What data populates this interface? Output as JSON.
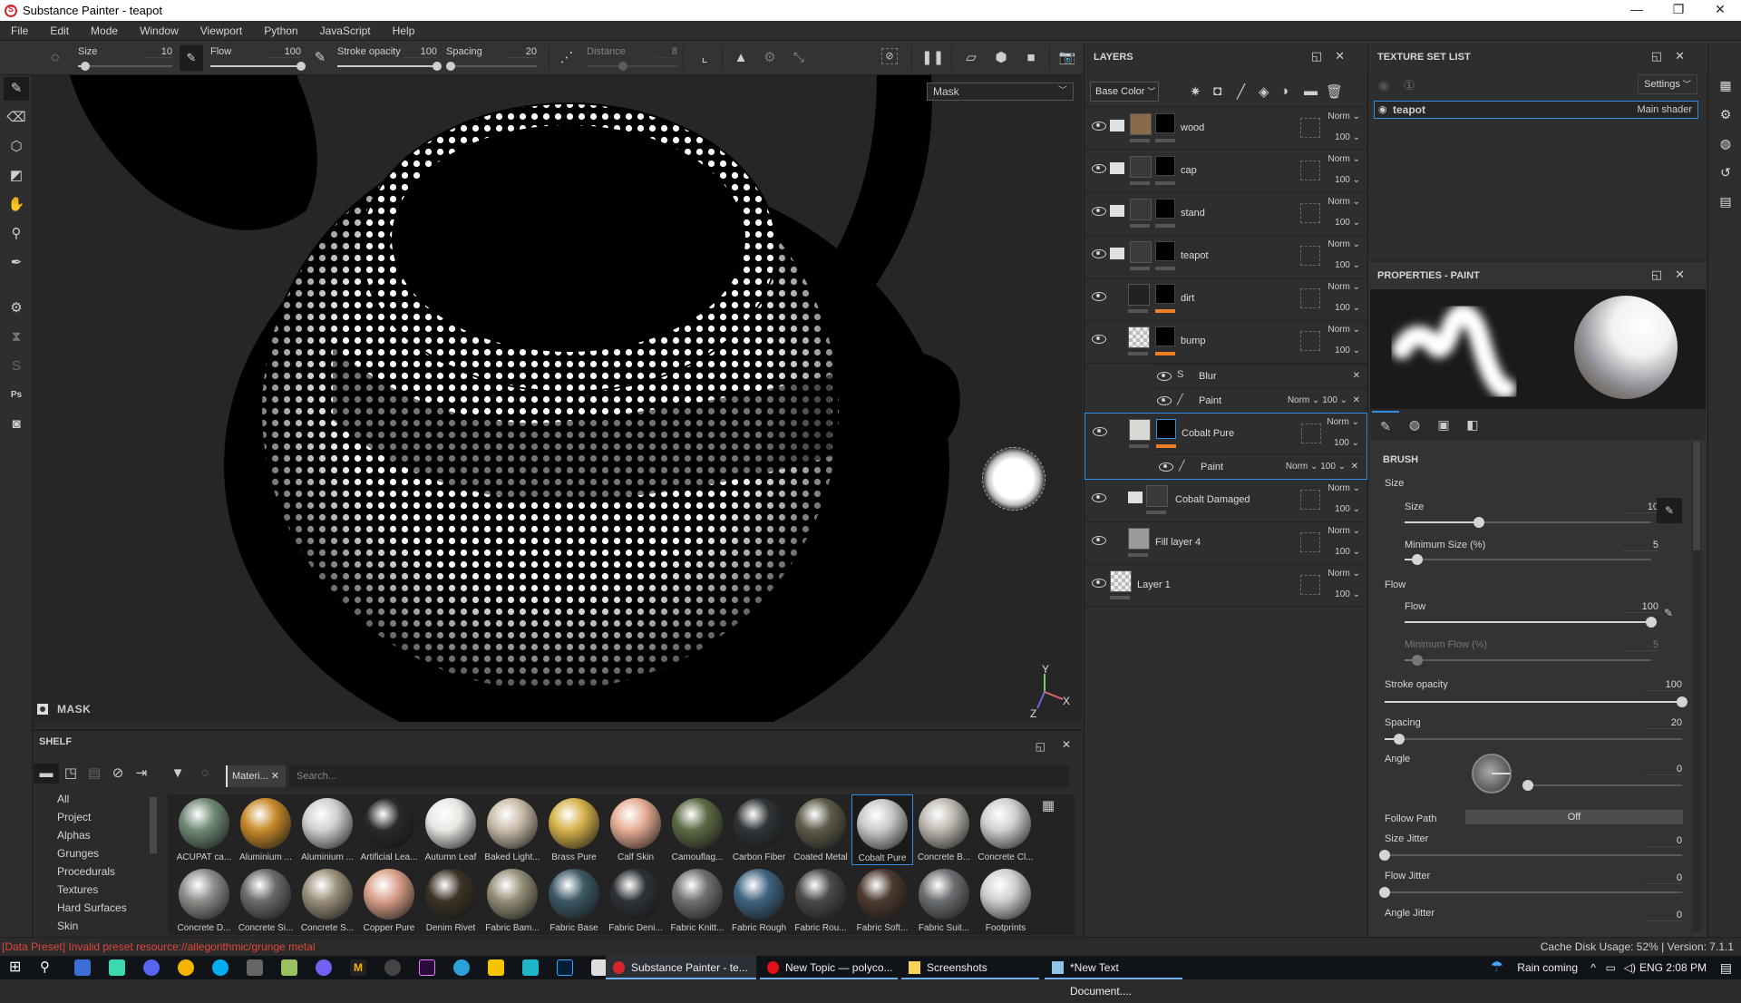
{
  "window": {
    "title": "Substance Painter - teapot",
    "minimize": "—",
    "restore": "❐",
    "close": "✕"
  },
  "menu": [
    "File",
    "Edit",
    "Mode",
    "Window",
    "Viewport",
    "Python",
    "JavaScript",
    "Help"
  ],
  "toolbar": {
    "size": {
      "label": "Size",
      "value": "10",
      "fraction": 0.08
    },
    "flow": {
      "label": "Flow",
      "value": "100",
      "fraction": 1.0
    },
    "stroke_opacity": {
      "label": "Stroke opacity",
      "value": "100",
      "fraction": 1.0
    },
    "spacing": {
      "label": "Spacing",
      "value": "20",
      "fraction": 0.05
    },
    "distance": {
      "label": "Distance",
      "value": "8",
      "fraction": 0.4,
      "disabled": true
    }
  },
  "left_tools": [
    "paint-brush",
    "eraser",
    "projection",
    "polygon-fill",
    "smudge",
    "clone-stamp",
    "color-picker",
    "substance-source",
    "bake",
    "substance-share",
    "photoshop",
    "iray"
  ],
  "viewport": {
    "channel_select": "Mask",
    "mask_label": "MASK",
    "axis": {
      "x": "X",
      "y": "Y",
      "z": "Z"
    }
  },
  "shelf": {
    "title": "SHELF",
    "filter_chip": "Materi...",
    "search_placeholder": "Search...",
    "categories": [
      "All",
      "Project",
      "Alphas",
      "Grunges",
      "Procedurals",
      "Textures",
      "Hard Surfaces",
      "Skin"
    ],
    "materials_row1": [
      {
        "name": "ACUPAT ca...",
        "color": "#6f8a76"
      },
      {
        "name": "Aluminium ...",
        "color": "#c88a2a"
      },
      {
        "name": "Aluminium ...",
        "color": "#cfcfcf"
      },
      {
        "name": "Artificial Lea...",
        "color": "#2a2a2a"
      },
      {
        "name": "Autumn Leaf",
        "color": "#e8e6e2"
      },
      {
        "name": "Baked Light...",
        "color": "#c9bca8"
      },
      {
        "name": "Brass Pure",
        "color": "#d6b24a"
      },
      {
        "name": "Calf Skin",
        "color": "#e6ad94"
      },
      {
        "name": "Camouflag...",
        "color": "#5d6a45"
      },
      {
        "name": "Carbon Fiber",
        "color": "#303538"
      },
      {
        "name": "Coated Metal",
        "color": "#5e5b4a"
      },
      {
        "name": "Cobalt Pure",
        "color": "#c8c8c8",
        "selected": true
      },
      {
        "name": "Concrete B...",
        "color": "#bdb8b0"
      },
      {
        "name": "Concrete Cl...",
        "color": "#cfcfcf"
      }
    ],
    "materials_row2": [
      {
        "name": "Concrete D...",
        "color": "#8d8d8a"
      },
      {
        "name": "Concrete Si...",
        "color": "#6b6b6b"
      },
      {
        "name": "Concrete S...",
        "color": "#9b8f7a"
      },
      {
        "name": "Copper Pure",
        "color": "#d9a08a"
      },
      {
        "name": "Denim Rivet",
        "color": "#3c3326"
      },
      {
        "name": "Fabric Bam...",
        "color": "#958e77"
      },
      {
        "name": "Fabric Base",
        "color": "#3d5966"
      },
      {
        "name": "Fabric Deni...",
        "color": "#2f3338"
      },
      {
        "name": "Fabric Knitt...",
        "color": "#707070"
      },
      {
        "name": "Fabric Rough",
        "color": "#3f6481"
      },
      {
        "name": "Fabric Rou...",
        "color": "#4a4a4a"
      },
      {
        "name": "Fabric Soft...",
        "color": "#4d3a30"
      },
      {
        "name": "Fabric Suit...",
        "color": "#6c6f72"
      },
      {
        "name": "Footprints",
        "color": "#cfcfcf"
      }
    ]
  },
  "layers": {
    "title": "LAYERS",
    "channel": "Base Color",
    "items": [
      {
        "name": "wood",
        "type": "folder",
        "blend": "Norm",
        "opacity": "100"
      },
      {
        "name": "cap",
        "type": "folder",
        "blend": "Norm",
        "opacity": "100"
      },
      {
        "name": "stand",
        "type": "folder",
        "blend": "Norm",
        "opacity": "100"
      },
      {
        "name": "teapot",
        "type": "folder-open",
        "blend": "Norm",
        "opacity": "100"
      },
      {
        "name": "dirt",
        "type": "fill",
        "blend": "Norm",
        "opacity": "100"
      },
      {
        "name": "bump",
        "type": "paint",
        "blend": "Norm",
        "opacity": "100"
      },
      {
        "name": "Cobalt Pure",
        "type": "fill",
        "blend": "Norm",
        "opacity": "100",
        "selected": true
      },
      {
        "name": "Cobalt Damaged",
        "type": "folder",
        "blend": "Norm",
        "opacity": "100"
      },
      {
        "name": "Fill layer 4",
        "type": "fill",
        "blend": "Norm",
        "opacity": "100"
      },
      {
        "name": "Layer 1",
        "type": "paint",
        "blend": "Norm",
        "opacity": "100"
      }
    ],
    "effects": {
      "bump_blur": {
        "name": "Blur"
      },
      "bump_paint": {
        "name": "Paint",
        "blend": "Norm",
        "opacity": "100"
      },
      "cobalt_paint": {
        "name": "Paint",
        "blend": "Norm",
        "opacity": "100"
      }
    }
  },
  "texture_set": {
    "title": "TEXTURE SET LIST",
    "settings": "Settings",
    "item_name": "teapot",
    "item_shader": "Main shader"
  },
  "properties": {
    "title": "PROPERTIES - PAINT",
    "section": "BRUSH",
    "size_group": "Size",
    "size": {
      "label": "Size",
      "value": "10",
      "fraction": 0.3
    },
    "min_size": {
      "label": "Minimum Size (%)",
      "value": "5",
      "fraction": 0.05
    },
    "flow_group": "Flow",
    "flow": {
      "label": "Flow",
      "value": "100",
      "fraction": 1.0
    },
    "min_flow": {
      "label": "Minimum Flow (%)",
      "value": "5",
      "fraction": 0.05
    },
    "stroke_opacity": {
      "label": "Stroke opacity",
      "value": "100",
      "fraction": 1.0
    },
    "spacing": {
      "label": "Spacing",
      "value": "20",
      "fraction": 0.05
    },
    "angle": {
      "label": "Angle",
      "value": "0",
      "fraction": 0.0
    },
    "follow_path": {
      "label": "Follow Path",
      "value": "Off"
    },
    "size_jitter": {
      "label": "Size Jitter",
      "value": "0",
      "fraction": 0.0
    },
    "flow_jitter": {
      "label": "Flow Jitter",
      "value": "0",
      "fraction": 0.0
    },
    "angle_jitter": {
      "label": "Angle Jitter",
      "value": "0"
    }
  },
  "status": {
    "message": "[Data Preset] Invalid preset resource://allegorithmic/grunge metal",
    "cache": "Cache Disk Usage:   52% | Version: 7.1.1"
  },
  "taskbar": {
    "tasks": [
      "Substance Painter - te...",
      "New Topic — polyco...",
      "Screenshots",
      "*New Text Document...."
    ],
    "weather": "Rain coming",
    "lang": "ENG",
    "time": "2:08 PM"
  }
}
